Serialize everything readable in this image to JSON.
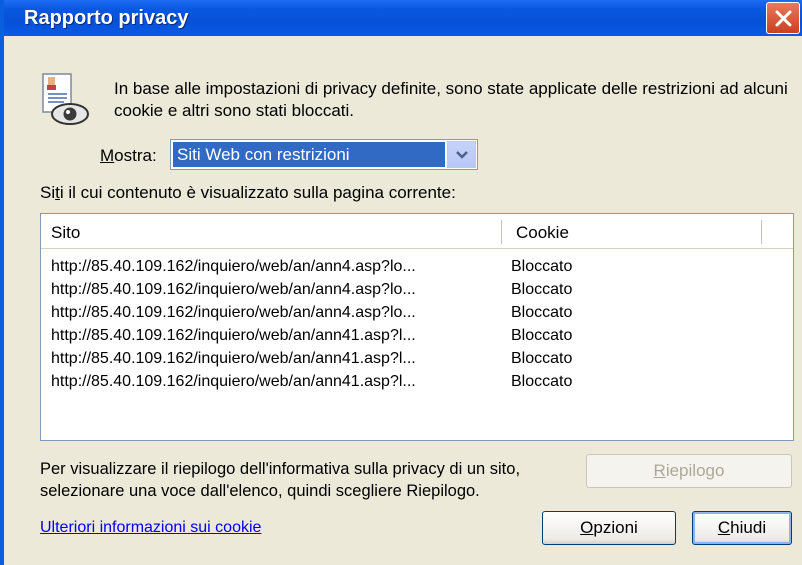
{
  "window": {
    "title": "Rapporto privacy"
  },
  "info": {
    "message": "In base alle impostazioni di privacy definite, sono state applicate delle restrizioni ad alcuni cookie e altri sono stati bloccati."
  },
  "filter": {
    "label_prefix": "",
    "label_access": "M",
    "label_rest": "ostra:",
    "selected": "Siti Web con restrizioni"
  },
  "sites": {
    "label_pre": "Si",
    "label_access": "t",
    "label_rest": "i il cui contenuto è visualizzato sulla pagina corrente:",
    "columns": [
      "Sito",
      "Cookie"
    ],
    "rows": [
      {
        "site": "http://85.40.109.162/inquiero/web/an/ann4.asp?lo...",
        "cookie": "Bloccato"
      },
      {
        "site": "http://85.40.109.162/inquiero/web/an/ann4.asp?lo...",
        "cookie": "Bloccato"
      },
      {
        "site": "http://85.40.109.162/inquiero/web/an/ann4.asp?lo...",
        "cookie": "Bloccato"
      },
      {
        "site": "http://85.40.109.162/inquiero/web/an/ann41.asp?l...",
        "cookie": "Bloccato"
      },
      {
        "site": "http://85.40.109.162/inquiero/web/an/ann41.asp?l...",
        "cookie": "Bloccato"
      },
      {
        "site": "http://85.40.109.162/inquiero/web/an/ann41.asp?l...",
        "cookie": "Bloccato"
      }
    ]
  },
  "summary": {
    "text": "Per visualizzare il riepilogo dell'informativa sulla privacy di un sito, selezionare una voce dall'elenco, quindi scegliere Riepilogo.",
    "button_access": "R",
    "button_rest": "iepilogo"
  },
  "footer": {
    "link": "Ulteriori informazioni sui cookie",
    "options_access": "O",
    "options_rest": "pzioni",
    "close_access": "C",
    "close_rest": "hiudi"
  },
  "icons": {
    "close": "close-icon",
    "privacy": "privacy-report-icon",
    "dropdown": "chevron-down-icon"
  }
}
